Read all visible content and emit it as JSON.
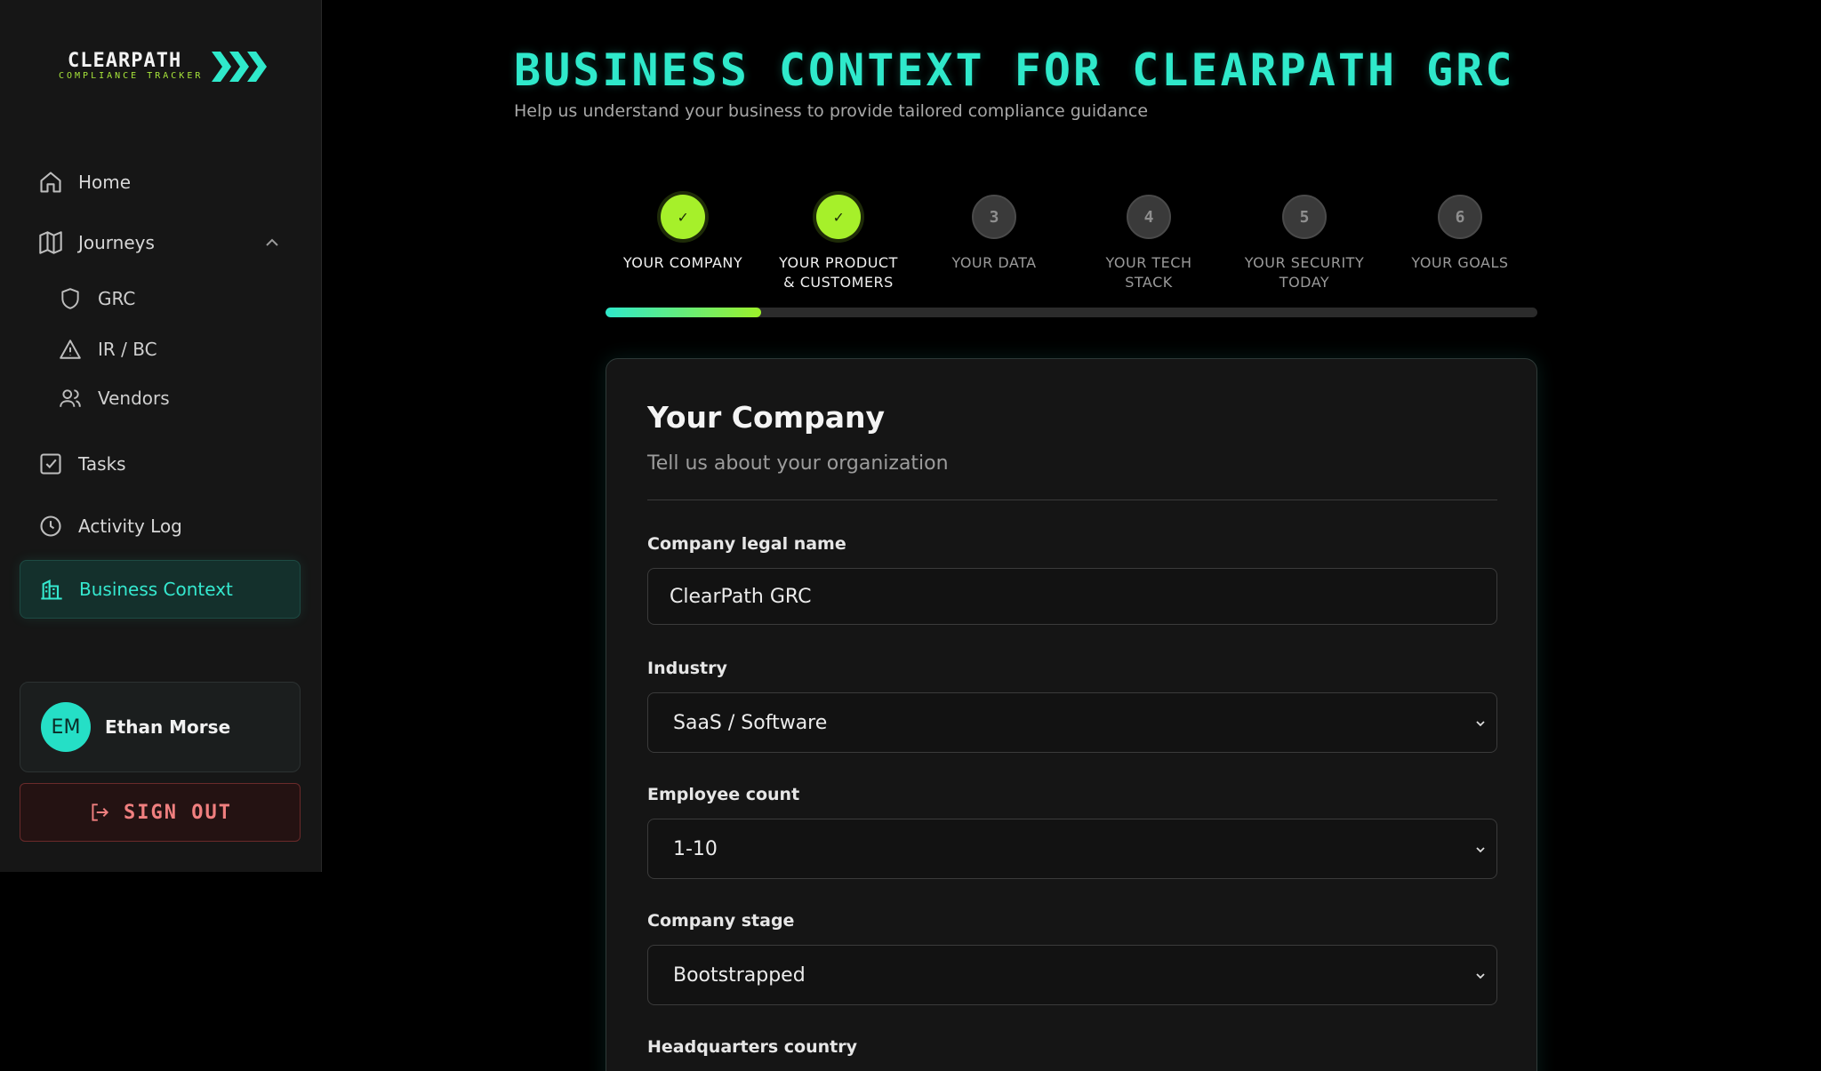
{
  "app": {
    "logo_title": "CLEARPATH",
    "logo_subtitle": "COMPLIANCE TRACKER"
  },
  "sidebar": {
    "items": [
      {
        "label": "Home",
        "icon": "home-icon"
      },
      {
        "label": "Journeys",
        "icon": "map-icon",
        "expanded": true
      },
      {
        "label": "GRC",
        "icon": "shield-icon"
      },
      {
        "label": "IR / BC",
        "icon": "alert-triangle-icon"
      },
      {
        "label": "Vendors",
        "icon": "users-icon"
      },
      {
        "label": "Tasks",
        "icon": "checkbox-icon"
      },
      {
        "label": "Activity Log",
        "icon": "clock-icon"
      },
      {
        "label": "Business Context",
        "icon": "building-icon",
        "active": true
      }
    ],
    "user": {
      "initials": "EM",
      "name": "Ethan Morse"
    },
    "sign_out_label": "SIGN OUT"
  },
  "header": {
    "title": "BUSINESS CONTEXT FOR CLEARPATH GRC",
    "subtitle": "Help us understand your business to provide tailored compliance guidance"
  },
  "stepper": {
    "steps": [
      {
        "number": "1",
        "label_line1": "YOUR COMPANY",
        "label_line2": "",
        "status": "done"
      },
      {
        "number": "2",
        "label_line1": "YOUR PRODUCT",
        "label_line2": "& CUSTOMERS",
        "status": "done"
      },
      {
        "number": "3",
        "label_line1": "YOUR DATA",
        "label_line2": "",
        "status": "todo"
      },
      {
        "number": "4",
        "label_line1": "YOUR TECH",
        "label_line2": "STACK",
        "status": "todo"
      },
      {
        "number": "5",
        "label_line1": "YOUR SECURITY",
        "label_line2": "TODAY",
        "status": "todo"
      },
      {
        "number": "6",
        "label_line1": "YOUR GOALS",
        "label_line2": "",
        "status": "todo"
      }
    ],
    "progress_fraction": 0.1667
  },
  "form": {
    "title": "Your Company",
    "subtitle": "Tell us about your organization",
    "fields": {
      "legal_name": {
        "label": "Company legal name",
        "value": "ClearPath GRC"
      },
      "industry": {
        "label": "Industry",
        "value": "SaaS / Software"
      },
      "employee_count": {
        "label": "Employee count",
        "value": "1-10"
      },
      "stage": {
        "label": "Company stage",
        "value": "Bootstrapped"
      },
      "hq_country": {
        "label": "Headquarters country"
      }
    }
  },
  "colors": {
    "accent": "#2fe9cb",
    "done": "#a6f02a",
    "danger": "#f07f7f",
    "background": "#000000",
    "sidebar": "#161616"
  }
}
